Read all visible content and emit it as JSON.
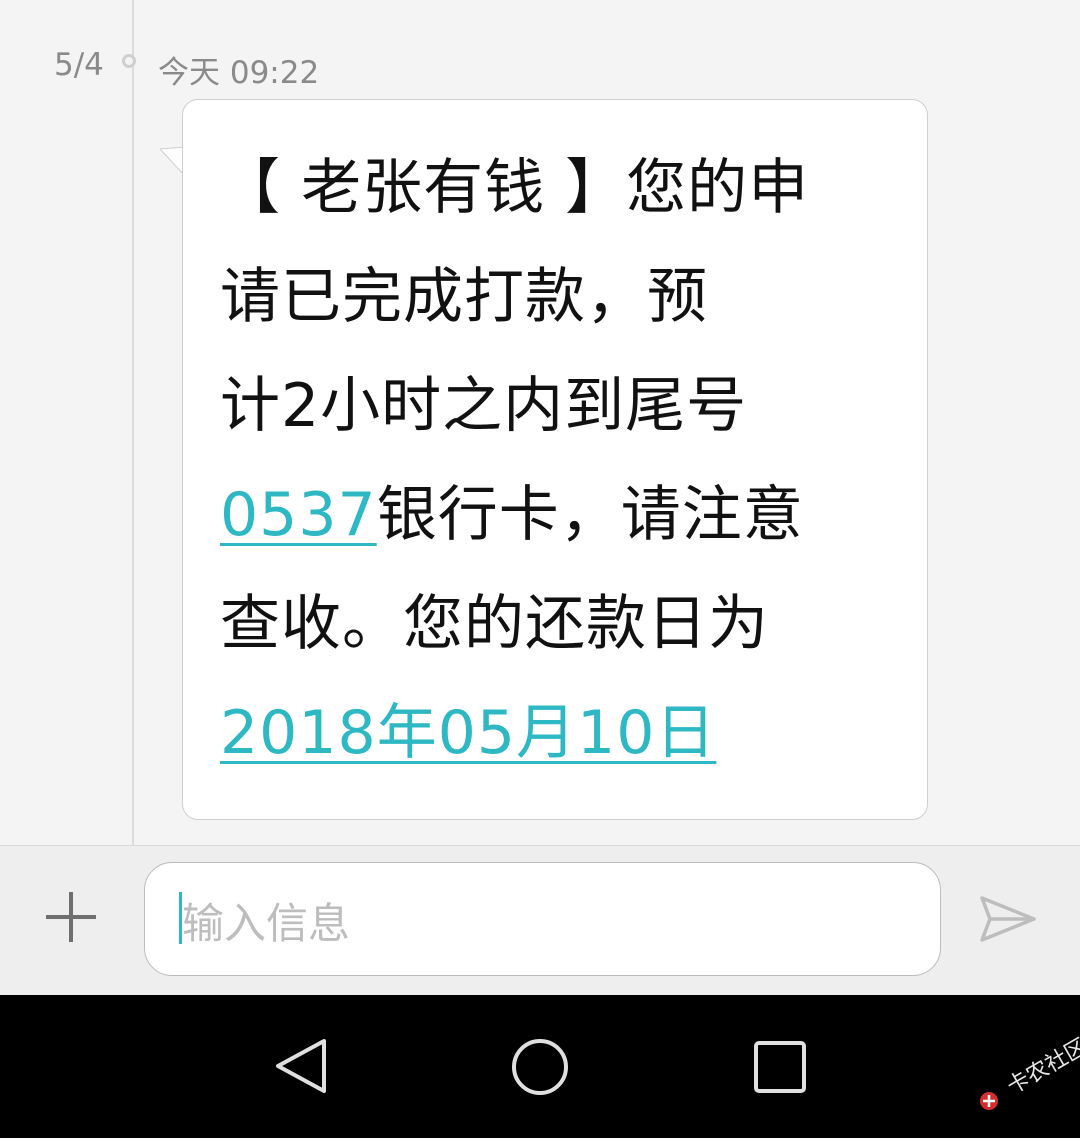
{
  "thread": {
    "date": "5/4",
    "time": "今天 09:22"
  },
  "message": {
    "line1": "【 老张有钱 】您的申",
    "line2": "请已完成打款，预",
    "line3": "计2小时之内到尾号",
    "card_number": "0537",
    "line4_rest": "银行卡，请注意",
    "line5": "查收。您的还款日为",
    "due_date": "2018年05月10日"
  },
  "composer": {
    "placeholder": "输入信息",
    "add_icon": "plus-icon",
    "send_icon": "send-icon"
  },
  "navbar": {
    "back_icon": "back-triangle-icon",
    "home_icon": "home-circle-icon",
    "recent_icon": "recent-square-icon"
  },
  "watermark": {
    "text": "卡农社区"
  },
  "colors": {
    "link": "#2db8c4",
    "background": "#f4f4f4",
    "bubble": "#ffffff",
    "navbar": "#000000"
  }
}
